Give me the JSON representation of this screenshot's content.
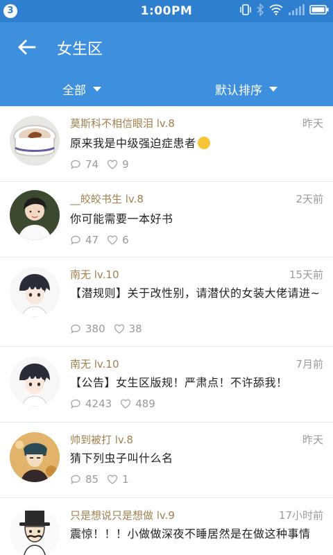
{
  "status_bar": {
    "notification_count": "3",
    "time": "1:00PM",
    "icons": [
      "vibrate-icon",
      "bluetooth-icon",
      "wifi-icon",
      "signal-icon",
      "battery-icon"
    ]
  },
  "header": {
    "title": "女生区",
    "filters": [
      {
        "label": "全部"
      },
      {
        "label": "默认排序"
      }
    ]
  },
  "colors": {
    "status_bar": "#2f7fd0",
    "app_bar": "#3f8fdf",
    "username": "#a08050",
    "meta": "#9a9a9a"
  },
  "posts": [
    {
      "username": "莫斯科不相信眼泪 lv.8",
      "time": "昨天",
      "text": "原来我是中级强迫症患者",
      "comments": "74",
      "likes": "9",
      "avatar": "coffee-cup"
    },
    {
      "username": "__皎皎书生 lv.8",
      "time": "2天前",
      "text": "你可能需要一本好书",
      "comments": "47",
      "likes": "6",
      "avatar": "photo-person"
    },
    {
      "username": "南无 lv.10",
      "time": "15天前",
      "text": "【潜规则】关于改性别，请潜伏的女装大佬请进~",
      "comments": "380",
      "likes": "38",
      "avatar": "anime-boy"
    },
    {
      "username": "南无 lv.10",
      "time": "7月前",
      "text": "【公告】女生区版规！严肃点！不许舔我！",
      "comments": "4243",
      "likes": "489",
      "avatar": "anime-boy"
    },
    {
      "username": "帅到被打 lv.8",
      "time": "昨天",
      "text": "猜下列虫子叫什么名",
      "comments": "85",
      "likes": "1",
      "avatar": "cartoon-dark"
    },
    {
      "username": "只是想说只是想做 lv.9",
      "time": "17小时前",
      "text": "震惊！！！小做做深夜不睡居然是在做这种事情",
      "comments": "",
      "likes": "",
      "avatar": "top-hat-gentleman"
    }
  ]
}
